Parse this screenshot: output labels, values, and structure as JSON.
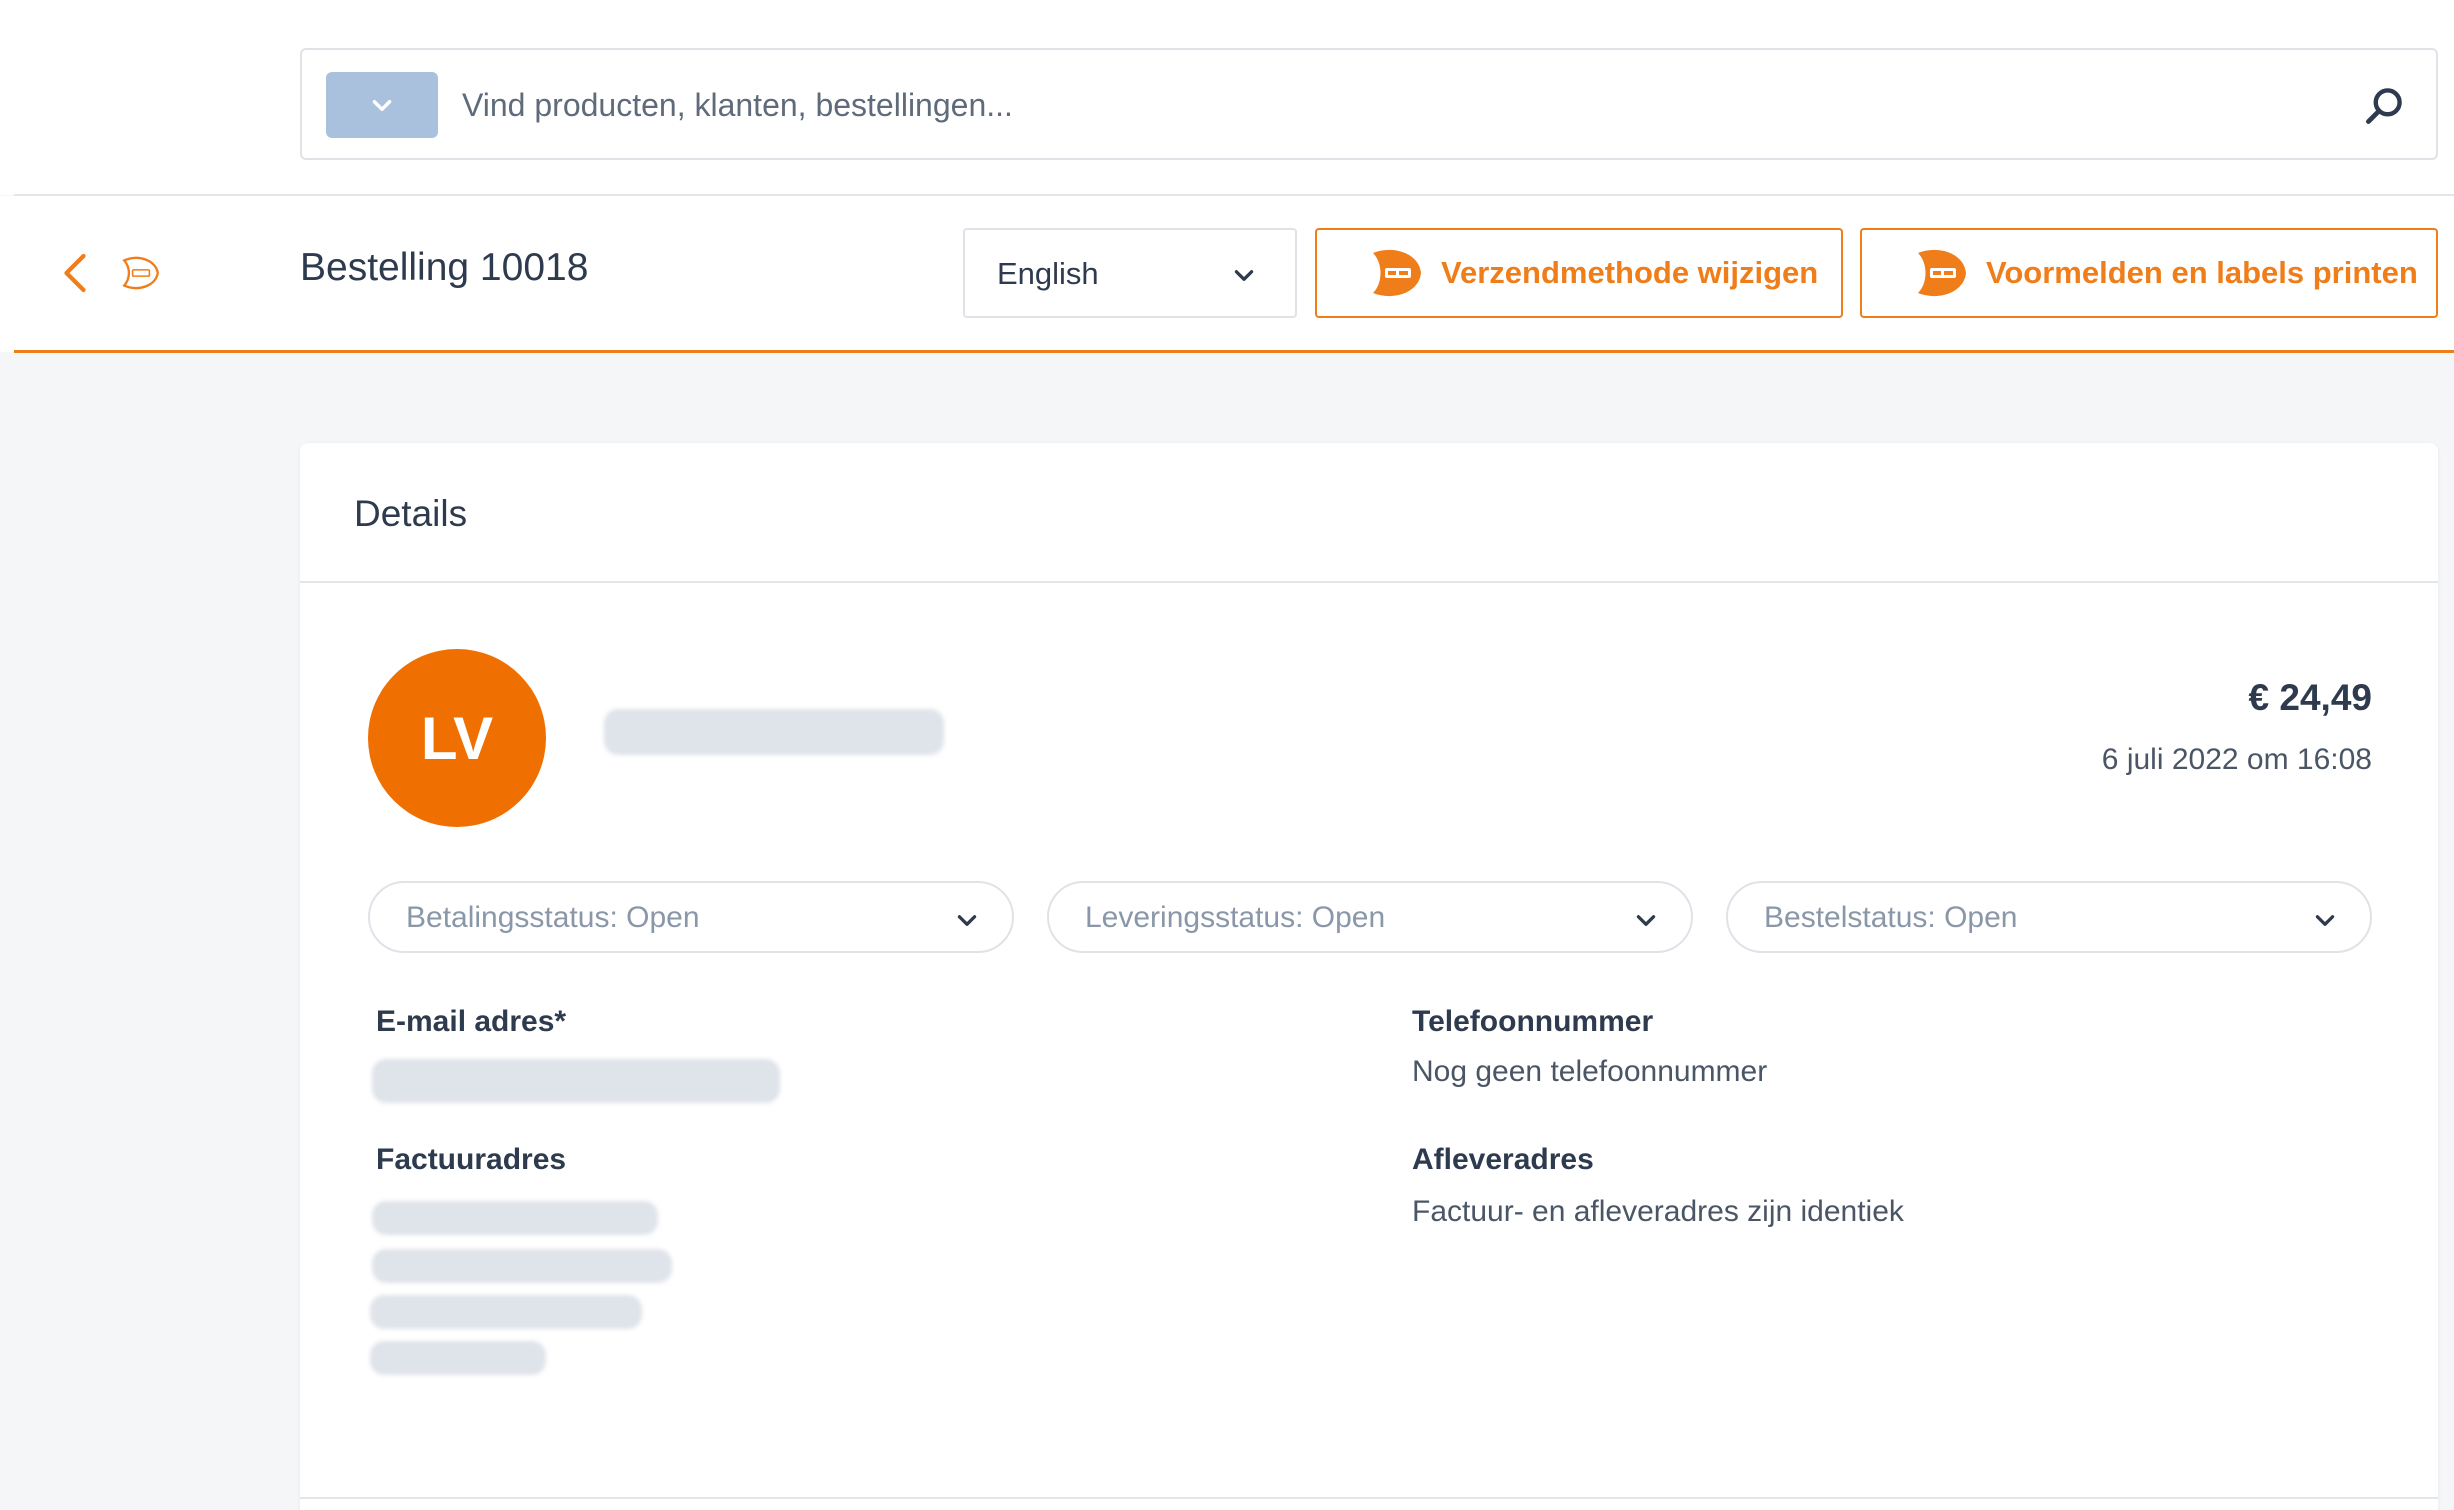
{
  "search": {
    "placeholder": "Vind producten, klanten, bestellingen..."
  },
  "header": {
    "title": "Bestelling 10018",
    "language": "English",
    "change_shipping_label": "Verzendmethode wijzigen",
    "print_labels_label": "Voormelden en labels printen"
  },
  "details": {
    "title": "Details",
    "avatar_initials": "LV",
    "amount": "€ 24,49",
    "date": "6 juli 2022 om 16:08",
    "payment_status": "Betalingsstatus: Open",
    "delivery_status": "Leveringsstatus: Open",
    "order_status": "Bestelstatus: Open",
    "email_label": "E-mail adres*",
    "phone_label": "Telefoonnummer",
    "phone_value": "Nog geen telefoonnummer",
    "billing_label": "Factuuradres",
    "shipping_label": "Afleveradres",
    "shipping_value": "Factuur- en afleveradres zijn identiek"
  },
  "colors": {
    "accent": "#ef7d1a",
    "avatar": "#ef7000",
    "search_scope": "#a9c1dd"
  }
}
